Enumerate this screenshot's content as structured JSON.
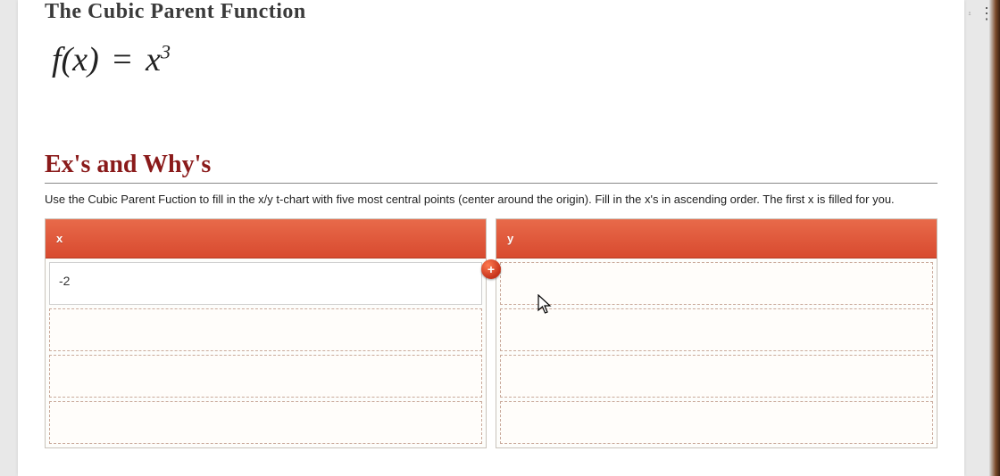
{
  "header": {
    "title": "The Cubic Parent Function"
  },
  "equation": {
    "lhs": "f(x)",
    "eq": "=",
    "rhs_base": "x",
    "rhs_exp": "3"
  },
  "section": {
    "heading": "Ex's and Why's",
    "instructions": "Use the Cubic Parent Fuction to fill in the x/y t-chart with five most central points (center around the origin). Fill in the x's in ascending order. The first x is filled for you."
  },
  "tchart": {
    "x_label": "x",
    "y_label": "y",
    "add_label": "+",
    "rows": [
      {
        "x": "-2",
        "y": ""
      },
      {
        "x": "",
        "y": ""
      },
      {
        "x": "",
        "y": ""
      },
      {
        "x": "",
        "y": ""
      }
    ]
  },
  "toolbar": {
    "share_icon": "share-icon",
    "more_icon": "more-vertical-icon"
  }
}
